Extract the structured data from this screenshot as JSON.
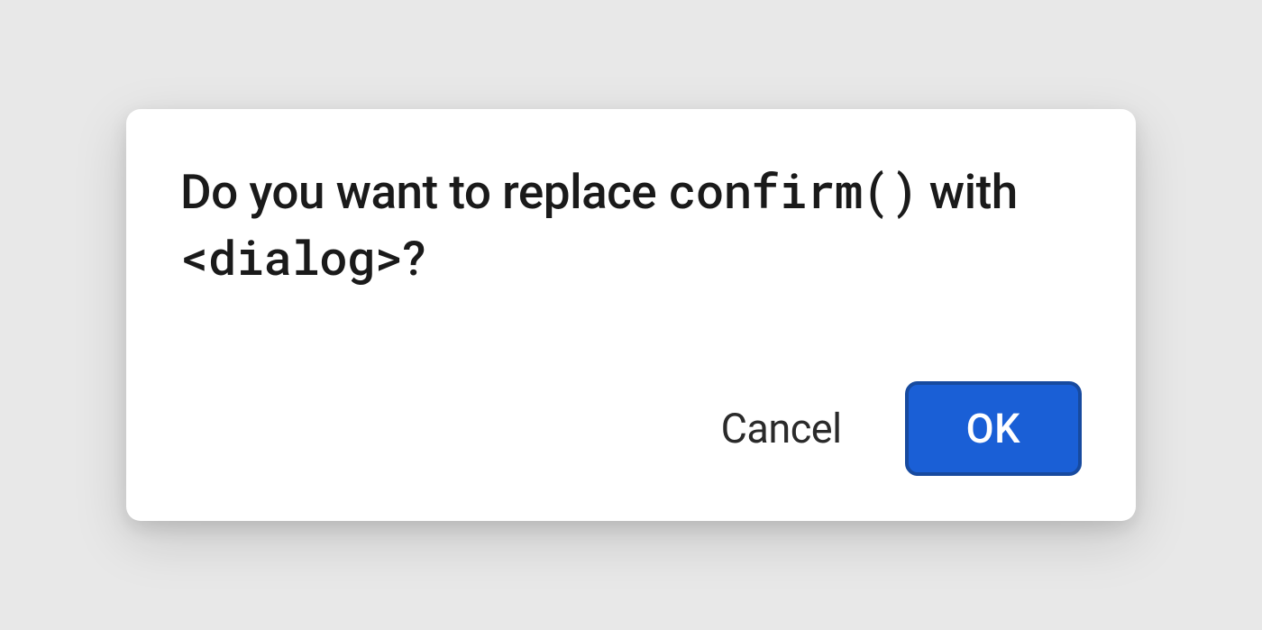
{
  "dialog": {
    "message_part1": "Do you want to replace ",
    "message_code1": "confirm()",
    "message_part2": " with ",
    "message_code2": "<dialog>",
    "message_part3": "?",
    "cancel_label": "Cancel",
    "ok_label": "OK"
  }
}
